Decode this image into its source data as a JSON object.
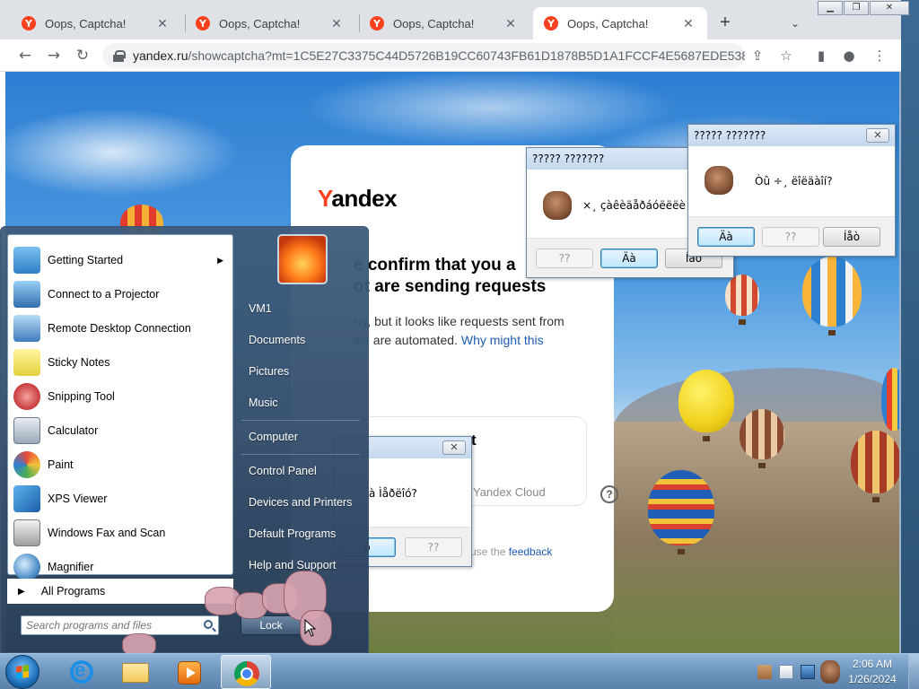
{
  "browser": {
    "tabs": [
      {
        "title": "Oops, Captcha!",
        "favicon": "Y",
        "active": false
      },
      {
        "title": "Oops, Captcha!",
        "favicon": "Y",
        "active": false
      },
      {
        "title": "Oops, Captcha!",
        "favicon": "Y",
        "active": false
      },
      {
        "title": "Oops, Captcha!",
        "favicon": "Y",
        "active": true
      }
    ],
    "new_tab": "+",
    "tab_search": "⌄",
    "window_buttons": {
      "minimize": "▁",
      "maximize": "❐",
      "close": "✕"
    },
    "url_host": "yandex.ru",
    "url_path": "/showcaptcha?mt=1C5E27C3375C44D5726B19CC60743FB61D1878B5D1A1FCCF4E5687EDE5388C..."
  },
  "captcha": {
    "logo_y": "Y",
    "logo_rest": "andex",
    "heading": "e confirm that you a\not are sending requests",
    "text_before_link": "rry, but it looks like requests sent from\nice are automated.",
    "link": "Why might this",
    "robot_box_title": "t",
    "cloud_label": "Yandex Cloud",
    "help": "?",
    "feedback_prefix": "use the ",
    "feedback_link": "feedback"
  },
  "dialogs": [
    {
      "title": "????? ???????",
      "message": "×¸ çàêèäåðáóëëëè òòåã",
      "buttons": [
        "??",
        "Äà",
        "Íåò"
      ],
      "close": "✕"
    },
    {
      "title": "????? ???????",
      "message": "Òû ÷¸ ëîëäàîí?",
      "buttons": [
        "Äà",
        "??",
        "Íåò"
      ],
      "close": "✕"
    },
    {
      "title": "",
      "message": "à Ìåðëîó?",
      "buttons": [
        "ó",
        "??"
      ],
      "close": "✕"
    }
  ],
  "start_menu": {
    "programs": [
      {
        "label": "Getting Started",
        "icon": "getting-started-icon",
        "submenu": true
      },
      {
        "label": "Connect to a Projector",
        "icon": "projector-icon",
        "submenu": false
      },
      {
        "label": "Remote Desktop Connection",
        "icon": "remote-desktop-icon",
        "submenu": false
      },
      {
        "label": "Sticky Notes",
        "icon": "sticky-notes-icon",
        "submenu": false
      },
      {
        "label": "Snipping Tool",
        "icon": "snipping-tool-icon",
        "submenu": false
      },
      {
        "label": "Calculator",
        "icon": "calculator-icon",
        "submenu": false
      },
      {
        "label": "Paint",
        "icon": "paint-icon",
        "submenu": false
      },
      {
        "label": "XPS Viewer",
        "icon": "xps-viewer-icon",
        "submenu": false
      },
      {
        "label": "Windows Fax and Scan",
        "icon": "fax-scan-icon",
        "submenu": false
      },
      {
        "label": "Magnifier",
        "icon": "magnifier-icon",
        "submenu": false
      }
    ],
    "all_programs": "All Programs",
    "search_placeholder": "Search programs and files",
    "right_items": [
      "VM1",
      "Documents",
      "Pictures",
      "Music",
      "Computer",
      "Control Panel",
      "Devices and Printers",
      "Default Programs",
      "Help and Support"
    ],
    "lock_label": "Lock",
    "lock_arrow": "▸"
  },
  "taskbar": {
    "time": "2:06 AM",
    "date": "1/26/2024"
  }
}
